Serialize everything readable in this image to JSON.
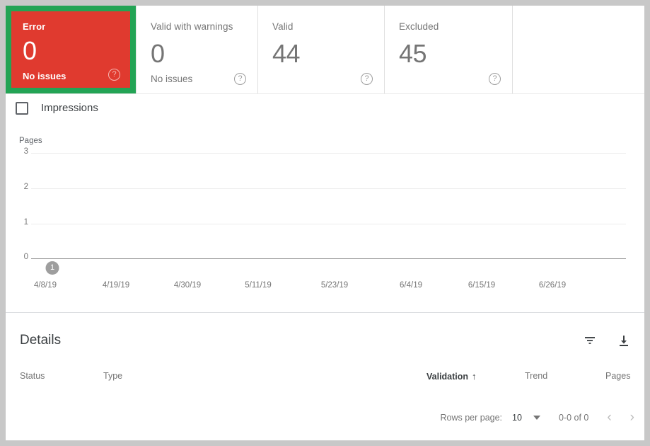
{
  "summary_cards": [
    {
      "title": "Error",
      "count": "0",
      "subtitle": "No issues",
      "selected": true,
      "help_icon": "help-circle-icon",
      "bg_color": "#e03a2f",
      "selection_color": "#23a455"
    },
    {
      "title": "Valid with warnings",
      "count": "0",
      "subtitle": "No issues",
      "selected": false,
      "help_icon": "help-circle-icon"
    },
    {
      "title": "Valid",
      "count": "44",
      "subtitle": "",
      "selected": false,
      "help_icon": "help-circle-icon"
    },
    {
      "title": "Excluded",
      "count": "45",
      "subtitle": "",
      "selected": false,
      "help_icon": "help-circle-icon"
    }
  ],
  "chart_legend": {
    "label": "Impressions",
    "checked": false
  },
  "chart_data": {
    "type": "line",
    "title": "",
    "ylabel": "Pages",
    "xlabel": "",
    "ylim": [
      0,
      3
    ],
    "yticks": [
      "0",
      "1",
      "2",
      "3"
    ],
    "grid": true,
    "legend_position": "top-left",
    "categories": [
      "4/8/19",
      "4/19/19",
      "4/30/19",
      "5/11/19",
      "5/23/19",
      "6/4/19",
      "6/15/19",
      "6/26/19"
    ],
    "series": [
      {
        "name": "Impressions",
        "values": [
          0,
          0,
          0,
          0,
          0,
          0,
          0,
          0
        ],
        "visible": false
      }
    ],
    "annotations": [
      {
        "label": "1",
        "x_position": "4/8/19"
      }
    ]
  },
  "details": {
    "title": "Details",
    "filter_icon": "filter-icon",
    "download_icon": "download-icon",
    "columns": [
      {
        "label": "Status",
        "sorted": false
      },
      {
        "label": "Type",
        "sorted": false
      },
      {
        "label": "Validation",
        "sorted": true,
        "sort_direction": "ascending",
        "sort_icon": "arrow-up-icon"
      },
      {
        "label": "Trend",
        "sorted": false
      },
      {
        "label": "Pages",
        "sorted": false
      }
    ],
    "rows": [],
    "pagination": {
      "rows_per_page_label": "Rows per page:",
      "rows_per_page_value": "10",
      "caret_icon": "chevron-down-icon",
      "range_label": "0-0 of 0",
      "prev_icon": "chevron-left-icon",
      "next_icon": "chevron-right-icon"
    }
  }
}
